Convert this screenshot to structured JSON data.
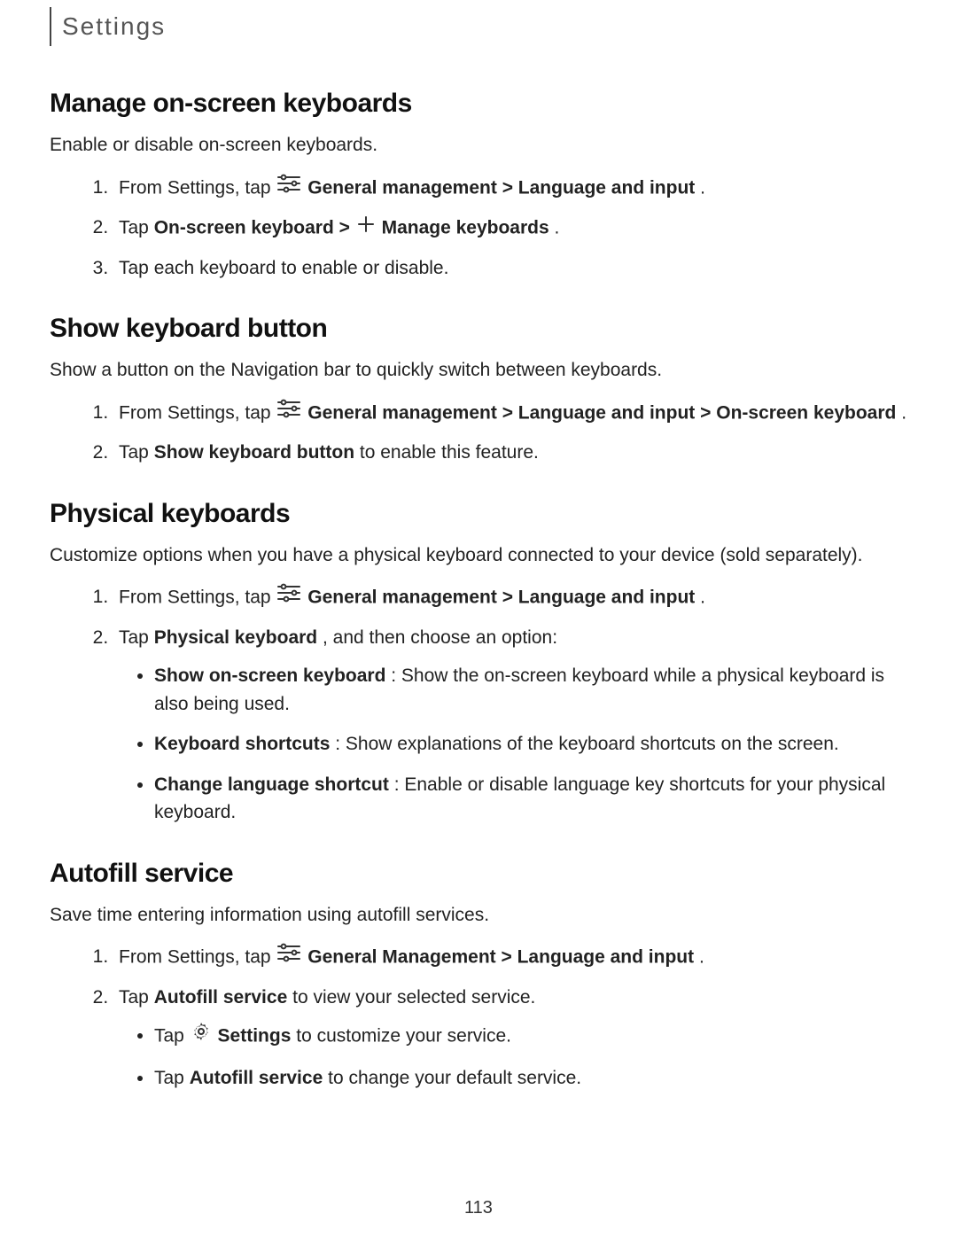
{
  "header": "Settings",
  "pageNumber": "113",
  "labels": {
    "general_management": "General management",
    "general_management_cap": "General Management",
    "language_and_input": "Language and input",
    "on_screen_keyboard": "On-screen keyboard",
    "manage_keyboards": "Manage keyboards",
    "show_keyboard_button": "Show keyboard button",
    "physical_keyboard": "Physical keyboard",
    "show_on_screen_keyboard": "Show on-screen keyboard",
    "keyboard_shortcuts": "Keyboard shortcuts",
    "change_language_shortcut": "Change language shortcut",
    "autofill_service": "Autofill service",
    "settings": "Settings"
  },
  "sections": {
    "s1": {
      "title": "Manage on-screen keyboards",
      "desc": "Enable or disable on-screen keyboards.",
      "step1_a": "From Settings, tap ",
      "step1_b": " > ",
      "step1_c": ".",
      "step2_a": "Tap ",
      "step2_b": " > ",
      "step2_c": ".",
      "step3": "Tap each keyboard to enable or disable."
    },
    "s2": {
      "title": "Show keyboard button",
      "desc": "Show a button on the Navigation bar to quickly switch between keyboards.",
      "step1_a": "From Settings, tap ",
      "step1_b": " > ",
      "step1_c": " > ",
      "step1_d": ".",
      "step2_a": "Tap ",
      "step2_b": " to enable this feature."
    },
    "s3": {
      "title": "Physical keyboards",
      "desc": "Customize options when you have a physical keyboard connected to your device (sold separately).",
      "step1_a": "From Settings, tap ",
      "step1_b": " > ",
      "step1_c": ".",
      "step2_a": "Tap ",
      "step2_b": ", and then choose an option:",
      "b1_b": ": Show the on-screen keyboard while a physical keyboard is also being used.",
      "b2_b": ": Show explanations of the keyboard shortcuts on the screen.",
      "b3_b": ": Enable or disable language key shortcuts for your physical keyboard."
    },
    "s4": {
      "title": "Autofill service",
      "desc": "Save time entering information using autofill services.",
      "step1_a": "From Settings, tap ",
      "step1_b": " > ",
      "step1_c": ".",
      "step2_a": "Tap ",
      "step2_b": " to view your selected service.",
      "b1_a": "Tap ",
      "b1_b": " to customize your service.",
      "b2_a": "Tap ",
      "b2_b": " to change your default service."
    }
  }
}
